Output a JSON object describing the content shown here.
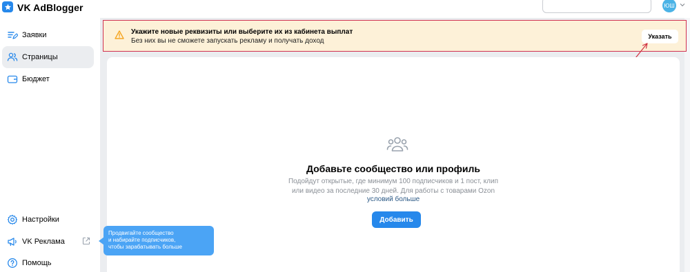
{
  "header": {
    "app_title": "VK AdBlogger",
    "logo_icon": "star-icon",
    "avatar_initials": "ЮШ",
    "accent_color": "#2688eb"
  },
  "sidebar": {
    "items": [
      {
        "label": "Заявки",
        "icon": "list-edit-icon",
        "active": false
      },
      {
        "label": "Страницы",
        "icon": "users-icon",
        "active": true
      },
      {
        "label": "Бюджет",
        "icon": "wallet-icon",
        "active": false
      }
    ],
    "bottom_items": [
      {
        "label": "Настройки",
        "icon": "gear-icon"
      },
      {
        "label": "VK Реклама",
        "icon": "megaphone-icon",
        "external_icon": "external-link-icon"
      },
      {
        "label": "Помощь",
        "icon": "help-icon"
      }
    ]
  },
  "banner": {
    "title": "Укажите новые реквизиты или выберите их из кабинета выплат",
    "subtitle": "Без них вы не сможете запускать рекламу и получать доход",
    "button_label": "Указать",
    "warning_color": "#f5a623",
    "border_color": "#d03050"
  },
  "empty_state": {
    "icon": "users-icon",
    "title": "Добавьте сообщество или профиль",
    "description_lines": [
      "Подойдут открытые, где минимум 100 подписчиков и 1 пост, клип",
      "или видео за последние 30 дней. Для работы с товарами Ozon"
    ],
    "link_text": "условий больше",
    "button_label": "Добавить"
  },
  "tooltip": {
    "lines": [
      "Продвигайте сообщество",
      "и набирайте подписчиков,",
      "чтобы зарабатывать больше"
    ],
    "color": "#4ba4f5"
  }
}
